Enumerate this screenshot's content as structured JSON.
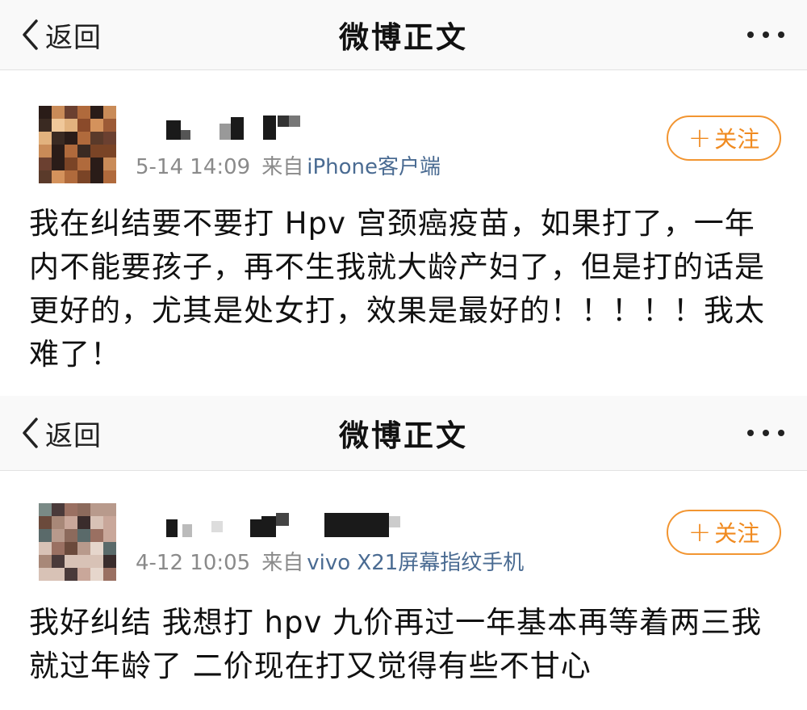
{
  "colors": {
    "follow_accent": "#f08a1f",
    "device_link": "#4a6b92",
    "meta_gray": "#8a8a8a",
    "navbar_bg": "#f9f9f9"
  },
  "screens": [
    {
      "nav": {
        "back_icon": "chevron-left-icon",
        "back_label": "返回",
        "title": "微博正文",
        "more_icon": "more-dots-icon"
      },
      "post": {
        "username_note": "",
        "time": "5-14 14:09",
        "from_label": "来自",
        "device": "iPhone客户端",
        "follow_label": "关注",
        "follow_icon": "plus-icon",
        "body": "我在纠结要不要打 Hpv 宫颈癌疫苗，如果打了，一年内不能要孩子，再不生我就大龄产妇了，但是打的话是更好的，尤其是处女打，效果是最好的！！！！！我太难了！"
      }
    },
    {
      "nav": {
        "back_icon": "chevron-left-icon",
        "back_label": "返回",
        "title": "微博正文",
        "more_icon": "more-dots-icon"
      },
      "post": {
        "username_note": "",
        "time": "4-12 10:05",
        "from_label": "来自",
        "device": "vivo X21屏幕指纹手机",
        "follow_label": "关注",
        "follow_icon": "plus-icon",
        "body": "我好纠结 我想打 hpv 九价再过一年基本再等着两三我就过年龄了 二价现在打又觉得有些不甘心"
      }
    }
  ]
}
